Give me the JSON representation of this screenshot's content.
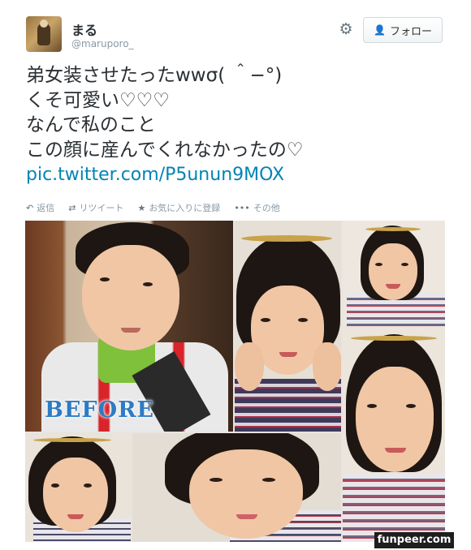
{
  "user": {
    "display_name": "まる",
    "screen_name": "@maruporo_"
  },
  "header": {
    "settings_icon": "gear-icon",
    "follow_label": "フォロー",
    "follow_icon": "add-user-icon"
  },
  "tweet": {
    "lines": [
      "弟女装させたったwwσ( ＾−°)",
      "くそ可愛い♡♡♡",
      "なんで私のこと",
      "この顔に産んでくれなかったの♡"
    ],
    "link": "pic.twitter.com/P5unun9MOX"
  },
  "actions": [
    {
      "label": "返信",
      "icon": "reply-icon"
    },
    {
      "label": "リツイート",
      "icon": "retweet-icon"
    },
    {
      "label": "お気に入りに登録",
      "icon": "star-icon"
    },
    {
      "label": "その他",
      "icon": "more-icon"
    }
  ],
  "photo": {
    "before_label": "BEFORE"
  },
  "watermark": "funpeer.com",
  "colors": {
    "link": "#0084b4",
    "before_text": "#2e7bc4",
    "meta_gray": "#8899a6"
  }
}
